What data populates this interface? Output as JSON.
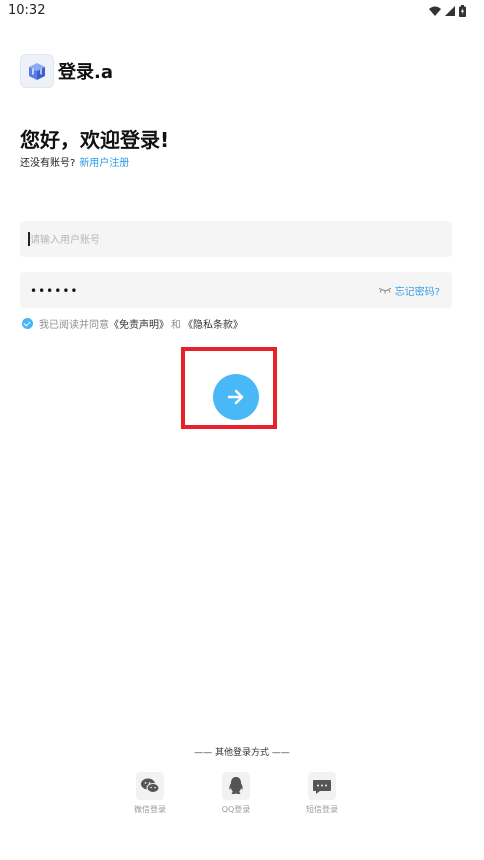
{
  "status_bar": {
    "time": "10:32"
  },
  "header": {
    "app_title": "登录.a"
  },
  "greeting": {
    "title": "您好，欢迎登录!",
    "no_account_text": "还没有账号?",
    "register_link": "新用户注册"
  },
  "form": {
    "account_placeholder": "请输入用户账号",
    "password_masked": "••••••",
    "forgot_password": "忘记密码?"
  },
  "agreement": {
    "prefix": "我已阅读并同意",
    "disclaimer": "《免责声明》",
    "and": "和",
    "privacy": "《隐私条款》",
    "checked": true
  },
  "submit": {
    "icon": "arrow-right-icon",
    "color": "#49b8f7"
  },
  "other_login": {
    "title": "—— 其他登录方式 ——",
    "options": [
      {
        "label": "微信登录",
        "icon": "wechat-icon"
      },
      {
        "label": "QQ登录",
        "icon": "qq-icon"
      },
      {
        "label": "短信登录",
        "icon": "sms-icon"
      }
    ]
  },
  "colors": {
    "accent": "#2f9ae6",
    "highlight": "#e8202a"
  }
}
